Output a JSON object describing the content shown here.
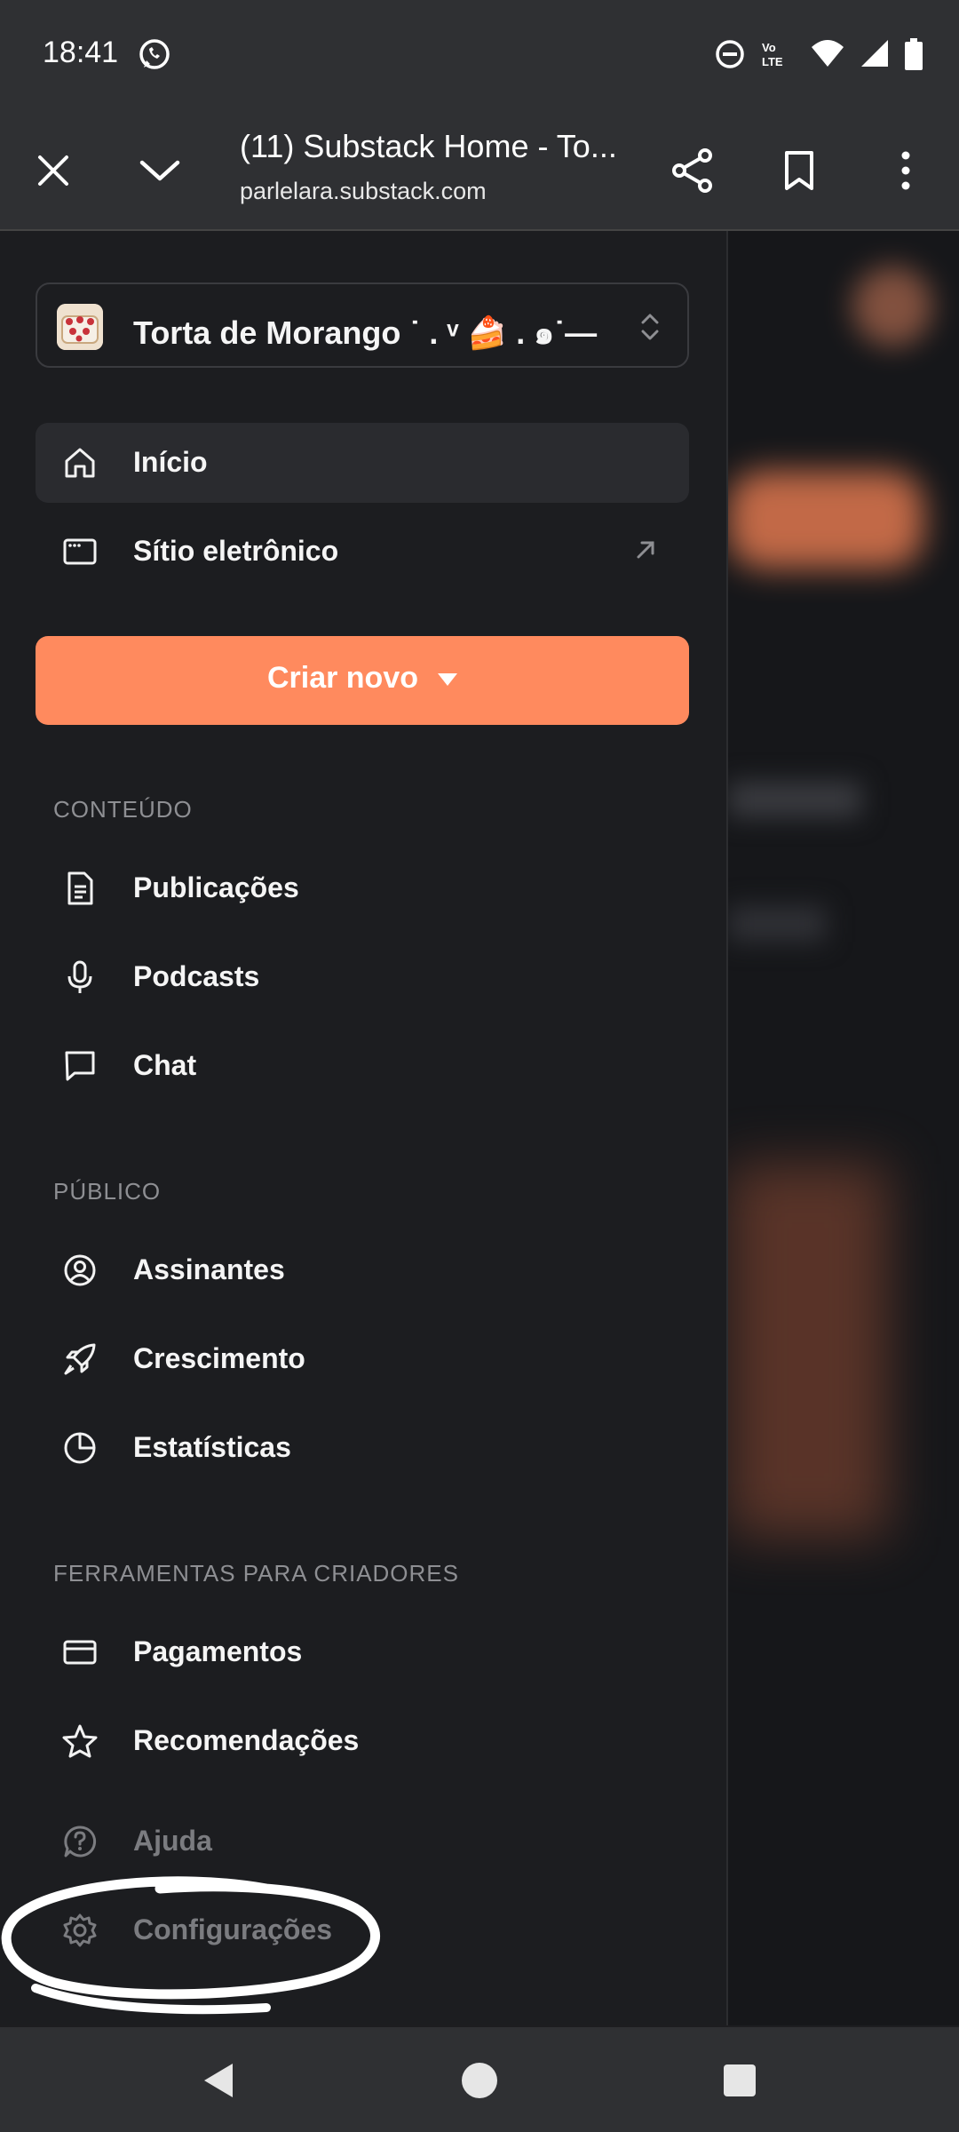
{
  "status_bar": {
    "time": "18:41",
    "icons": [
      "whatsapp-icon",
      "do-not-disturb-icon",
      "volte-icon",
      "wifi-icon",
      "signal-icon",
      "battery-icon"
    ],
    "volte_label": "Vo LTE"
  },
  "browser": {
    "title": "(11) Substack Home - To...",
    "url": "parlelara.substack.com",
    "icons": [
      "close-icon",
      "chevron-down-icon",
      "share-icon",
      "bookmark-icon",
      "more-vert-icon"
    ]
  },
  "drawer": {
    "publication_name": "Torta de Morango ˙ . ᵛ 🍰 . ๑˙—",
    "nav_top": [
      {
        "label": "Início",
        "icon": "home-icon",
        "active": true
      },
      {
        "label": "Sítio eletrônico",
        "icon": "browser-window-icon",
        "external": true
      }
    ],
    "create_button": "Criar novo",
    "sections": [
      {
        "title": "CONTEÚDO",
        "items": [
          {
            "label": "Publicações",
            "icon": "document-icon"
          },
          {
            "label": "Podcasts",
            "icon": "microphone-icon"
          },
          {
            "label": "Chat",
            "icon": "chat-bubble-icon"
          }
        ]
      },
      {
        "title": "PÚBLICO",
        "items": [
          {
            "label": "Assinantes",
            "icon": "user-circle-icon"
          },
          {
            "label": "Crescimento",
            "icon": "rocket-icon"
          },
          {
            "label": "Estatísticas",
            "icon": "pie-chart-icon"
          }
        ]
      },
      {
        "title": "FERRAMENTAS PARA CRIADORES",
        "items": [
          {
            "label": "Pagamentos",
            "icon": "credit-card-icon"
          },
          {
            "label": "Recomendações",
            "icon": "star-icon"
          }
        ]
      }
    ],
    "footer_items": [
      {
        "label": "Ajuda",
        "icon": "help-circle-icon"
      },
      {
        "label": "Configurações",
        "icon": "gear-icon"
      }
    ]
  },
  "colors": {
    "accent": "#ff8a5e",
    "drawer_bg": "#1c1d20",
    "chrome_bg": "#2f3033"
  },
  "nav_bar": {
    "icons": [
      "back-triangle-icon",
      "home-circle-icon",
      "recents-square-icon"
    ]
  }
}
